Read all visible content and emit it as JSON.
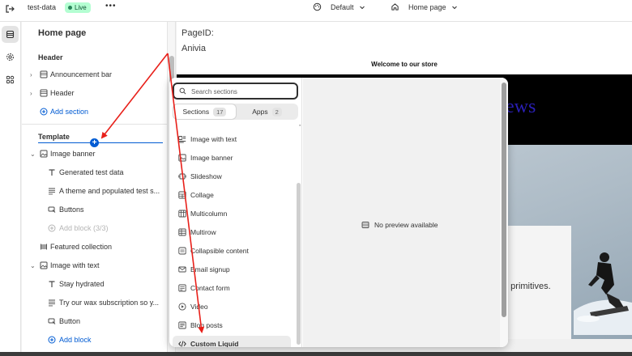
{
  "topbar": {
    "store_name": "test-data",
    "status_badge": "Live",
    "more": "•••",
    "theme_selector": "Default",
    "page_selector": "Home page"
  },
  "sidebar": {
    "title": "Home page",
    "header_group": {
      "label": "Header",
      "items": [
        "Announcement bar",
        "Header"
      ],
      "add_section": "Add section"
    },
    "template_group": {
      "label": "Template",
      "image_banner": {
        "label": "Image banner",
        "blocks": [
          "Generated test data",
          "A theme and populated test s...",
          "Buttons"
        ],
        "add_block": "Add block (3/3)"
      },
      "featured_collection": "Featured collection",
      "image_with_text": {
        "label": "Image with text",
        "blocks": [
          "Stay hydrated",
          "Try our wax subscription so y...",
          "Button"
        ],
        "add_block": "Add block"
      }
    }
  },
  "preview": {
    "page_id_label": "PageID:",
    "page_name": "Anivia",
    "welcome": "Welcome to our store",
    "hero_heading_fragment": "ews",
    "hero_text_fragment": "e primitives."
  },
  "picker": {
    "search_placeholder": "Search sections",
    "tabs": {
      "sections_label": "Sections",
      "sections_count": "17",
      "apps_label": "Apps",
      "apps_count": "2"
    },
    "sections": [
      "Image with text",
      "Image banner",
      "Slideshow",
      "Collage",
      "Multicolumn",
      "Multirow",
      "Collapsible content",
      "Email signup",
      "Contact form",
      "Video",
      "Blog posts",
      "Custom Liquid"
    ],
    "no_preview": "No preview available"
  },
  "colors": {
    "accent": "#005bd3",
    "annotation_arrow": "#e8201a",
    "live_badge_bg": "#b4fed2",
    "hero_heading": "#2a1fb5"
  }
}
